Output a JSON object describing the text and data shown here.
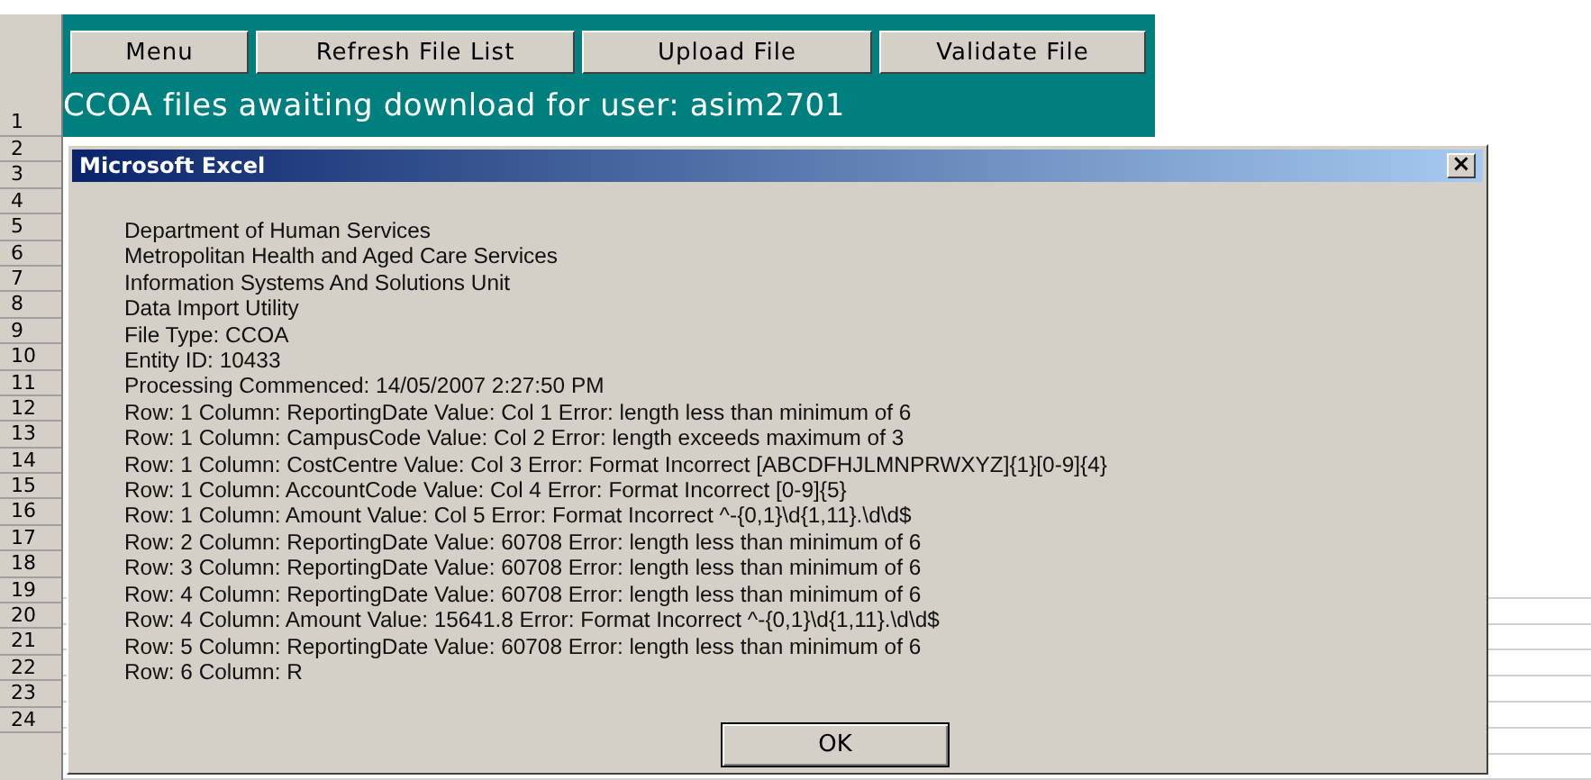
{
  "toolbar": {
    "buttons": [
      "Menu",
      "Refresh File List",
      "Upload File",
      "Validate File"
    ]
  },
  "banner": "CCOA files awaiting download for user: asim2701",
  "row_headers": [
    "1",
    "2",
    "3",
    "4",
    "5",
    "6",
    "7",
    "8",
    "9",
    "10",
    "11",
    "12",
    "13",
    "14",
    "15",
    "16",
    "17",
    "18",
    "19",
    "20",
    "21",
    "22",
    "23",
    "24"
  ],
  "dialog": {
    "title": "Microsoft Excel",
    "close": "×",
    "lines": [
      "Department of Human Services",
      "Metropolitan Health and Aged Care Services",
      "Information Systems And Solutions Unit",
      "Data Import Utility",
      "File Type: CCOA",
      "Entity ID: 10433",
      "Processing Commenced: 14/05/2007 2:27:50 PM",
      "Row: 1 Column: ReportingDate Value: Col 1 Error: length less than minimum of 6",
      "Row: 1 Column: CampusCode Value: Col 2 Error: length exceeds maximum of 3",
      "Row: 1 Column: CostCentre Value: Col 3 Error: Format Incorrect [ABCDFHJLMNPRWXYZ]{1}[0-9]{4}",
      "Row: 1 Column: AccountCode Value: Col 4 Error: Format Incorrect [0-9]{5}",
      "Row: 1 Column: Amount Value: Col 5 Error: Format Incorrect ^-{0,1}\\d{1,11}.\\d\\d$",
      "Row: 2 Column: ReportingDate Value: 60708 Error: length less than minimum of 6",
      "Row: 3 Column: ReportingDate Value: 60708 Error: length less than minimum of 6",
      "Row: 4 Column: ReportingDate Value: 60708 Error: length less than minimum of 6",
      "Row: 4 Column: Amount Value: 15641.8 Error: Format Incorrect ^-{0,1}\\d{1,11}.\\d\\d$",
      "Row: 5 Column: ReportingDate Value: 60708 Error: length less than minimum of 6",
      "Row: 6 Column: R"
    ],
    "button": "OK"
  }
}
